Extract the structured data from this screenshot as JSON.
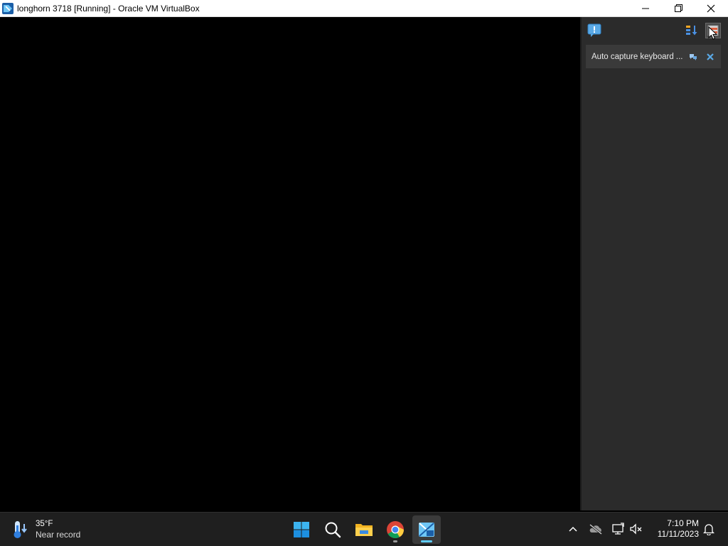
{
  "window": {
    "title": "longhorn 3718 [Running] - Oracle VM VirtualBox",
    "icon": "virtualbox-icon",
    "controls": [
      "minimize-icon",
      "restore-icon",
      "close-icon"
    ]
  },
  "notification_pane": {
    "left_button_icon": "message-icon",
    "sort_button_icon": "sort-icon",
    "hide_button_icon": "hide-pane-icon",
    "items": [
      {
        "text": "Auto capture keyboard ...",
        "actions": [
          "dont-show-again-icon",
          "close-icon"
        ]
      }
    ]
  },
  "taskbar": {
    "weather": {
      "temperature": "35°F",
      "description": "Near record",
      "icon": "thermometer-icon"
    },
    "apps": [
      {
        "name": "start",
        "icon": "windows-logo-icon"
      },
      {
        "name": "search",
        "icon": "search-icon"
      },
      {
        "name": "file-explorer",
        "icon": "folder-icon"
      },
      {
        "name": "chrome",
        "icon": "chrome-icon"
      },
      {
        "name": "virtualbox",
        "icon": "virtualbox-icon"
      }
    ],
    "tray": [
      "chevron-up-icon",
      "onedrive-icon",
      "network-icon",
      "volume-muted-icon",
      "bell-icon"
    ],
    "clock": {
      "time": "7:10 PM",
      "date": "11/11/2023"
    }
  },
  "colors": {
    "accent": "#60cdff",
    "pane_bg": "#2b2b2b",
    "taskbar_bg": "#1f1f1f"
  }
}
